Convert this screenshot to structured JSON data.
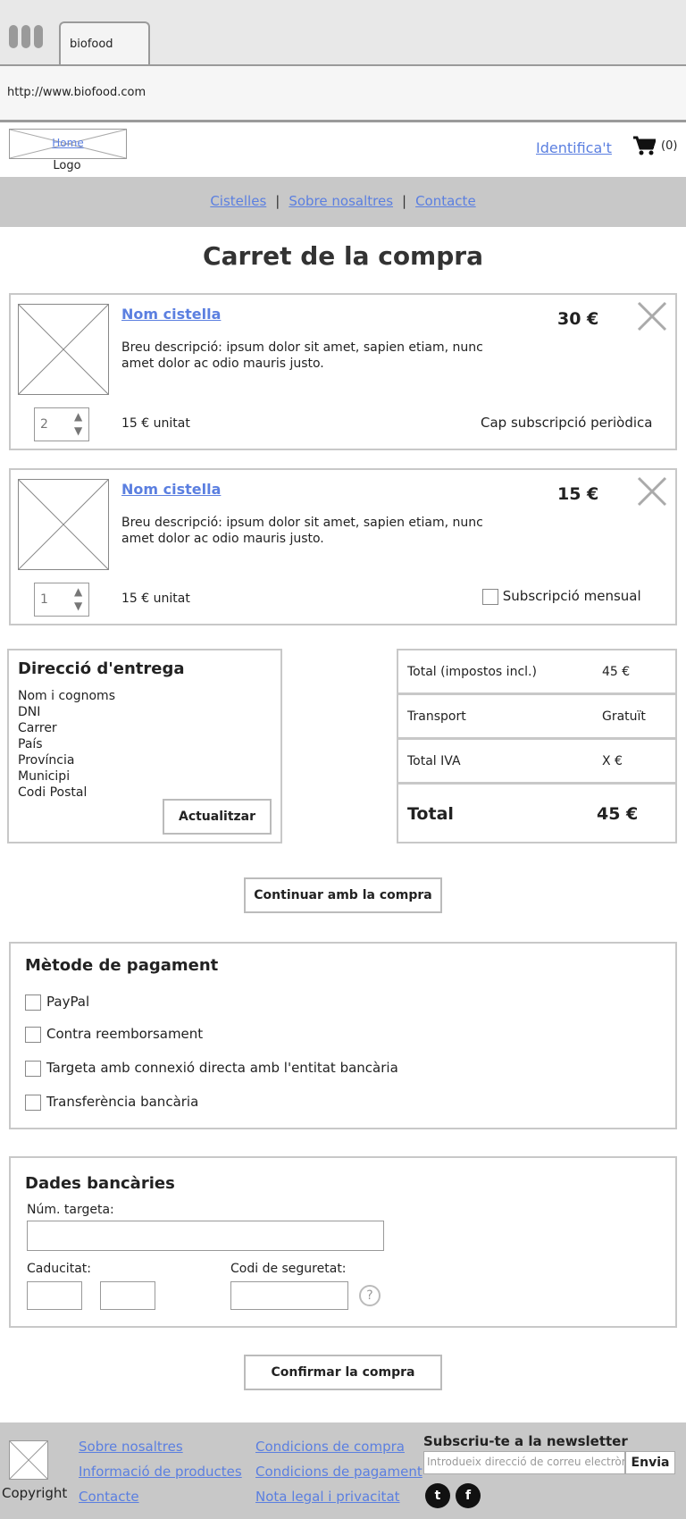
{
  "browser": {
    "tab_title": "biofood",
    "url": "http://www.biofood.com"
  },
  "header": {
    "logo_home": "Home",
    "logo_label": "Logo",
    "identify": "Identifica't",
    "cart_count": "(0)"
  },
  "nav": {
    "items": [
      "Cistelles",
      "Sobre nosaltres",
      "Contacte"
    ],
    "separator": "|"
  },
  "page_title": "Carret de la compra",
  "items": [
    {
      "name": "Nom cistella",
      "description": "Breu descripció: ipsum dolor sit amet, sapien etiam, nunc amet dolor ac odio mauris justo.",
      "price": "30 €",
      "quantity": "2",
      "unit": "15 € unitat",
      "subscription": "Cap subscripció periòdica"
    },
    {
      "name": "Nom cistella",
      "description": "Breu descripció: ipsum dolor sit amet, sapien etiam, nunc amet dolor ac odio mauris justo.",
      "price": "15 €",
      "quantity": "1",
      "unit": "15 € unitat",
      "subscription": "Subscripció mensual"
    }
  ],
  "address": {
    "title": "Direcció d'entrega",
    "fields": [
      "Nom i cognoms",
      "DNI",
      "Carrer",
      "País",
      "Província",
      "Municipi",
      "Codi Postal"
    ],
    "update_button": "Actualitzar"
  },
  "totals": {
    "rows": [
      {
        "label": "Total (impostos incl.)",
        "value": "45 €"
      },
      {
        "label": "Transport",
        "value": "Gratuït"
      },
      {
        "label": "Total IVA",
        "value": "X €"
      }
    ],
    "total_label": "Total",
    "total_value": "45 €"
  },
  "continue_button": "Continuar amb la compra",
  "payment": {
    "title": "Mètode de pagament",
    "options": [
      "PayPal",
      "Contra reemborsament",
      "Targeta amb connexió directa amb l'entitat bancària",
      "Transferència bancària"
    ]
  },
  "bank": {
    "title": "Dades bancàries",
    "card_label": "Núm. targeta:",
    "expiry_label": "Caducitat:",
    "security_label": "Codi de seguretat:",
    "help_symbol": "?"
  },
  "confirm_button": "Confirmar la compra",
  "footer": {
    "copyright": "Copyright",
    "col1": [
      "Sobre nosaltres",
      "Informació de productes",
      "Contacte"
    ],
    "col2": [
      "Condicions de compra",
      "Condicions de pagament",
      "Nota legal i privacitat"
    ],
    "newsletter_title": "Subscriu-te a la newsletter",
    "newsletter_placeholder": "Introdueix direcció de correu electrònic",
    "newsletter_button": "Envia",
    "social": [
      "twitter-icon",
      "facebook-icon"
    ]
  }
}
